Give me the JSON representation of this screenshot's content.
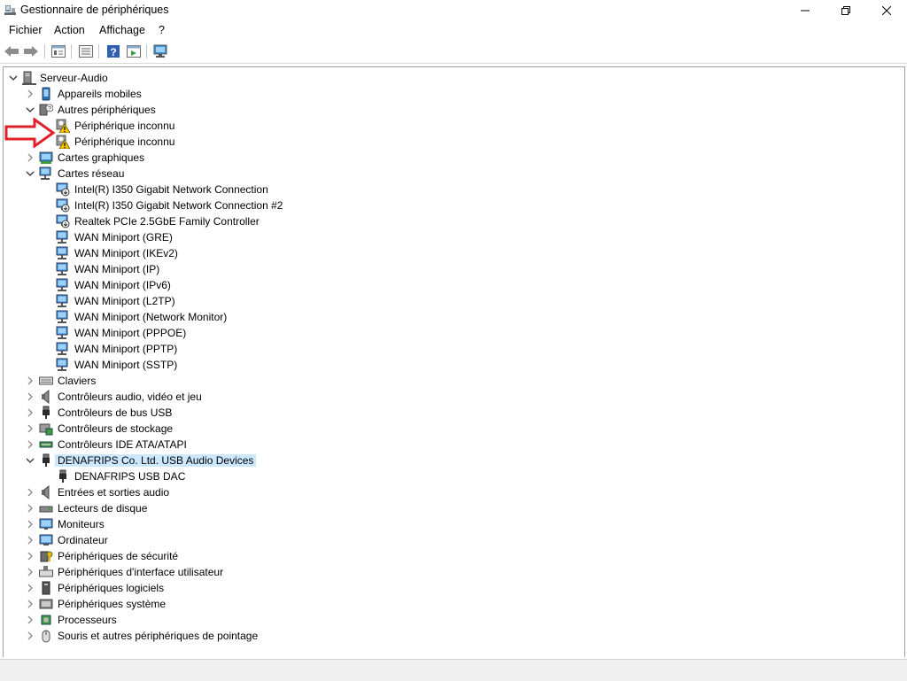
{
  "window": {
    "title": "Gestionnaire de périphériques",
    "controls": [
      "minimize",
      "restore",
      "close"
    ]
  },
  "menu": [
    "Fichier",
    "Action",
    "Affichage",
    "?"
  ],
  "toolbar_icons": [
    "back-icon",
    "forward-icon",
    "properties-view-icon",
    "update-driver-icon",
    "help-icon",
    "console-tree-icon",
    "monitor-scan-icon"
  ],
  "tree": {
    "root": "Serveur-Audio",
    "nodes": [
      {
        "label": "Appareils mobiles",
        "level": 1,
        "state": "collapsed",
        "icon": "mobile-device-icon"
      },
      {
        "label": "Autres périphériques",
        "level": 1,
        "state": "expanded",
        "icon": "unknown-device-icon"
      },
      {
        "label": "Périphérique inconnu",
        "level": 2,
        "state": "leaf",
        "icon": "warning-device-icon"
      },
      {
        "label": "Périphérique inconnu",
        "level": 2,
        "state": "leaf",
        "icon": "warning-device-icon"
      },
      {
        "label": "Cartes graphiques",
        "level": 1,
        "state": "collapsed",
        "icon": "display-adapter-icon"
      },
      {
        "label": "Cartes réseau",
        "level": 1,
        "state": "expanded",
        "icon": "network-adapter-icon"
      },
      {
        "label": "Intel(R) I350 Gigabit Network Connection",
        "level": 2,
        "state": "leaf",
        "icon": "network-disabled-icon"
      },
      {
        "label": "Intel(R) I350 Gigabit Network Connection #2",
        "level": 2,
        "state": "leaf",
        "icon": "network-disabled-icon"
      },
      {
        "label": "Realtek PCIe 2.5GbE Family Controller",
        "level": 2,
        "state": "leaf",
        "icon": "network-disabled-icon"
      },
      {
        "label": "WAN Miniport (GRE)",
        "level": 2,
        "state": "leaf",
        "icon": "network-adapter-icon"
      },
      {
        "label": "WAN Miniport (IKEv2)",
        "level": 2,
        "state": "leaf",
        "icon": "network-adapter-icon"
      },
      {
        "label": "WAN Miniport (IP)",
        "level": 2,
        "state": "leaf",
        "icon": "network-adapter-icon"
      },
      {
        "label": "WAN Miniport (IPv6)",
        "level": 2,
        "state": "leaf",
        "icon": "network-adapter-icon"
      },
      {
        "label": "WAN Miniport (L2TP)",
        "level": 2,
        "state": "leaf",
        "icon": "network-adapter-icon"
      },
      {
        "label": "WAN Miniport (Network Monitor)",
        "level": 2,
        "state": "leaf",
        "icon": "network-adapter-icon"
      },
      {
        "label": "WAN Miniport (PPPOE)",
        "level": 2,
        "state": "leaf",
        "icon": "network-adapter-icon"
      },
      {
        "label": "WAN Miniport (PPTP)",
        "level": 2,
        "state": "leaf",
        "icon": "network-adapter-icon"
      },
      {
        "label": "WAN Miniport (SSTP)",
        "level": 2,
        "state": "leaf",
        "icon": "network-adapter-icon"
      },
      {
        "label": "Claviers",
        "level": 1,
        "state": "collapsed",
        "icon": "keyboard-icon"
      },
      {
        "label": "Contrôleurs audio, vidéo et jeu",
        "level": 1,
        "state": "collapsed",
        "icon": "speaker-icon"
      },
      {
        "label": "Contrôleurs de bus USB",
        "level": 1,
        "state": "collapsed",
        "icon": "usb-icon"
      },
      {
        "label": "Contrôleurs de stockage",
        "level": 1,
        "state": "collapsed",
        "icon": "storage-controller-icon"
      },
      {
        "label": "Contrôleurs IDE ATA/ATAPI",
        "level": 1,
        "state": "collapsed",
        "icon": "ide-controller-icon"
      },
      {
        "label": "DENAFRIPS Co. Ltd. USB Audio Devices",
        "level": 1,
        "state": "expanded",
        "icon": "usb-icon",
        "selected": true
      },
      {
        "label": "DENAFRIPS USB DAC",
        "level": 2,
        "state": "leaf",
        "icon": "usb-icon"
      },
      {
        "label": "Entrées et sorties audio",
        "level": 1,
        "state": "collapsed",
        "icon": "speaker-icon"
      },
      {
        "label": "Lecteurs de disque",
        "level": 1,
        "state": "collapsed",
        "icon": "disk-drive-icon"
      },
      {
        "label": "Moniteurs",
        "level": 1,
        "state": "collapsed",
        "icon": "monitor-icon"
      },
      {
        "label": "Ordinateur",
        "level": 1,
        "state": "collapsed",
        "icon": "computer-icon"
      },
      {
        "label": "Périphériques de sécurité",
        "level": 1,
        "state": "collapsed",
        "icon": "security-device-icon"
      },
      {
        "label": "Périphériques d'interface utilisateur",
        "level": 1,
        "state": "collapsed",
        "icon": "hid-icon"
      },
      {
        "label": "Périphériques logiciels",
        "level": 1,
        "state": "collapsed",
        "icon": "software-device-icon"
      },
      {
        "label": "Périphériques système",
        "level": 1,
        "state": "collapsed",
        "icon": "system-device-icon"
      },
      {
        "label": "Processeurs",
        "level": 1,
        "state": "collapsed",
        "icon": "processor-icon"
      },
      {
        "label": "Souris et autres périphériques de pointage",
        "level": 1,
        "state": "collapsed",
        "icon": "mouse-icon"
      }
    ]
  },
  "colors": {
    "selection": "#cce8ff",
    "annotation_arrow": "#e0202a",
    "network_icon": "#3a8fd9"
  }
}
